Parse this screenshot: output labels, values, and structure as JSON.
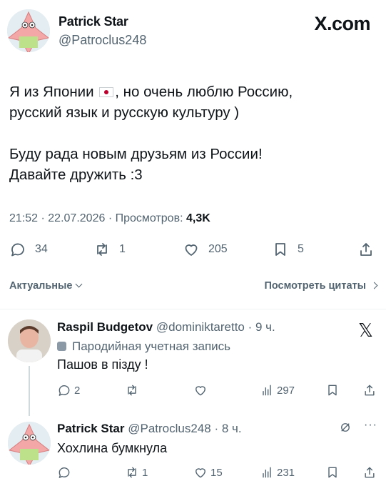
{
  "author": {
    "name": "Patrick Star",
    "handle": "@Patroclus248"
  },
  "brand": "X.com",
  "tweet": {
    "line1_pre": "Я из Японии",
    "line1_post": ", но очень люблю Россию,",
    "line2": "русский язык и русскую культуру )",
    "line3": "Буду рада новым друзьям из России!",
    "line4": "Давайте дружить :3"
  },
  "meta": {
    "time": "21:52",
    "sep1": "·",
    "date": "22.07.2026",
    "sep2": "·",
    "views_label": "Просмотров:",
    "views": "4,3K"
  },
  "actions": {
    "replies": "34",
    "reposts": "1",
    "likes": "205",
    "bookmarks": "5"
  },
  "sort": {
    "left": "Актуальные",
    "right": "Посмотреть цитаты"
  },
  "replies": [
    {
      "name": "Raspil Budgetov",
      "handle": "@dominiktaretto",
      "time": "· 9 ч.",
      "label": "Пародийная учетная запись",
      "text": "Пашов в пізду !",
      "replies": "2",
      "reposts": "",
      "likes": "",
      "views": "297"
    },
    {
      "name": "Patrick Star",
      "handle": "@Patroclus248",
      "time": "· 8 ч.",
      "text": "Хохлина бумкнула",
      "replies": "",
      "reposts": "1",
      "likes": "15",
      "views": "231"
    }
  ]
}
